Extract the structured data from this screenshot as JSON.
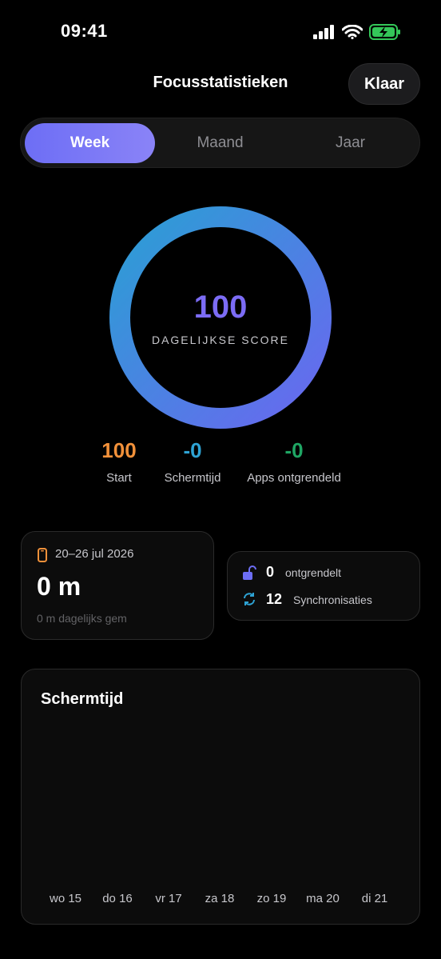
{
  "status_bar": {
    "time": "09:41"
  },
  "header": {
    "title": "Focusstatistieken",
    "done_label": "Klaar"
  },
  "tabs": [
    {
      "label": "Week",
      "active": true
    },
    {
      "label": "Maand",
      "active": false
    },
    {
      "label": "Jaar",
      "active": false
    }
  ],
  "score": {
    "value": "100",
    "label": "DAGELIJKSE SCORE",
    "fill_fraction": 1.0
  },
  "metrics": [
    {
      "value": "100",
      "label": "Start",
      "color": "#f2913a"
    },
    {
      "value": "-0",
      "label": "Schermtijd",
      "color": "#2ea3d4"
    },
    {
      "value": "-0",
      "label": "Apps ontgrendeld",
      "color": "#1fa664"
    }
  ],
  "week_card": {
    "range": "20–26 jul 2026",
    "total": "0 m",
    "average": "0 m dagelijks gem"
  },
  "mini_card": {
    "unlocked_value": "0",
    "unlocked_label": "ontgrendelt",
    "sync_value": "12",
    "sync_label": "Synchronisaties"
  },
  "chart": {
    "title": "Schermtijd",
    "days": [
      "wo 15",
      "do 16",
      "vr 17",
      "za 18",
      "zo 19",
      "ma 20",
      "di 21"
    ]
  },
  "colors": {
    "accent": "#6d6ef5",
    "ring_start": "#6a67f0",
    "ring_end": "#2a9fd4"
  }
}
